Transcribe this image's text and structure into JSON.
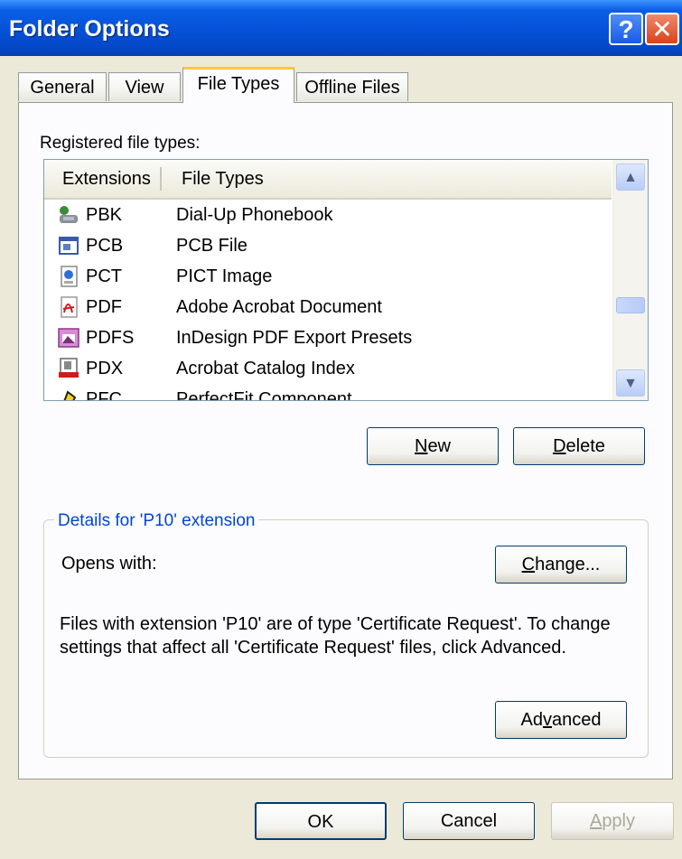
{
  "window": {
    "title": "Folder Options",
    "help_glyph": "?",
    "close_glyph": "✕"
  },
  "tabs": [
    {
      "label": "General"
    },
    {
      "label": "View"
    },
    {
      "label": "File Types"
    },
    {
      "label": "Offline Files"
    }
  ],
  "registered_label": "Registered file types:",
  "list": {
    "header_ext": "Extensions",
    "header_type": "File Types",
    "rows": [
      {
        "ext": "PBK",
        "type": "Dial-Up Phonebook",
        "icon": "phonebook-icon"
      },
      {
        "ext": "PCB",
        "type": "PCB File",
        "icon": "generic-file-icon"
      },
      {
        "ext": "PCT",
        "type": "PICT Image",
        "icon": "image-file-icon"
      },
      {
        "ext": "PDF",
        "type": "Adobe Acrobat Document",
        "icon": "pdf-icon"
      },
      {
        "ext": "PDFS",
        "type": "InDesign PDF Export Presets",
        "icon": "indesign-icon"
      },
      {
        "ext": "PDX",
        "type": "Acrobat Catalog Index",
        "icon": "catalog-index-icon"
      },
      {
        "ext": "PFC",
        "type": "PerfectFit Component",
        "icon": "component-icon"
      }
    ]
  },
  "buttons": {
    "new_pre": "",
    "new_ul": "N",
    "new_post": "ew",
    "delete_pre": "",
    "delete_ul": "D",
    "delete_post": "elete",
    "change_pre": "",
    "change_ul": "C",
    "change_post": "hange...",
    "advanced_pre": "Ad",
    "advanced_ul": "v",
    "advanced_post": "anced",
    "ok": "OK",
    "cancel": "Cancel",
    "apply_pre": "",
    "apply_ul": "A",
    "apply_post": "pply"
  },
  "details": {
    "title": "Details for 'P10' extension",
    "opens_with": "Opens with:",
    "description": "Files with extension 'P10' are of type 'Certificate Request'.  To change settings that affect all 'Certificate Request' files, click Advanced."
  },
  "colors": {
    "titlebar": "#0553d8",
    "dialog_bg": "#ece9d8",
    "group_title": "#0046d5",
    "active_tab_accent": "#ffc83c"
  }
}
